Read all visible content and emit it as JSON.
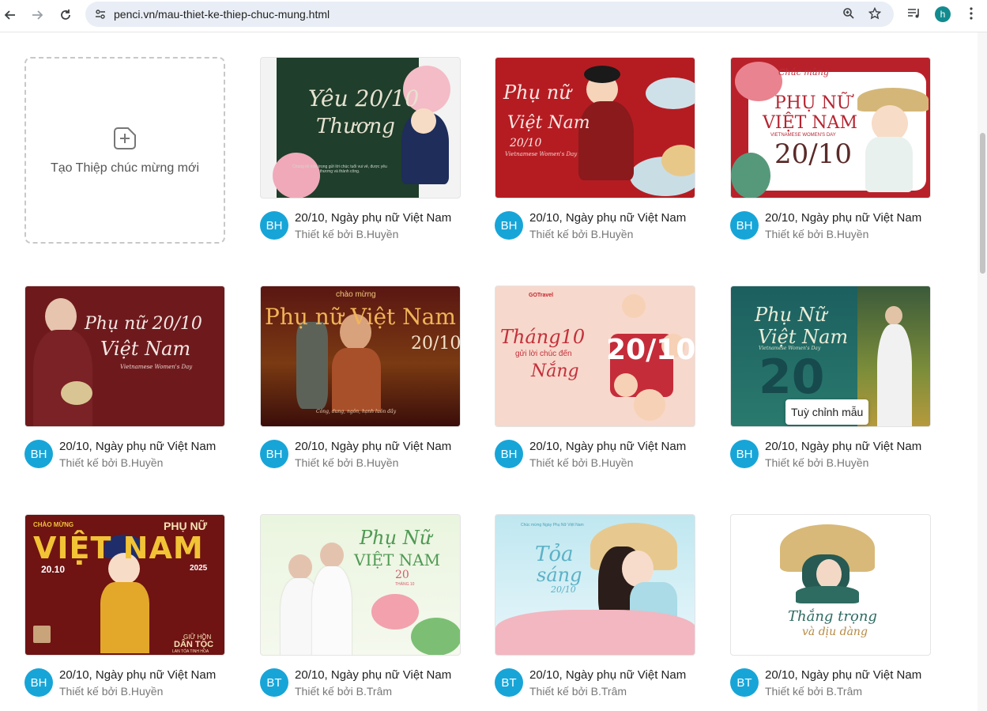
{
  "browser": {
    "url": "penci.vn/mau-thiet-ke-thiep-chuc-mung.html",
    "profile_initial": "h"
  },
  "create": {
    "label": "Tạo Thiệp chúc mừng mới"
  },
  "tooltip": "Tuỳ chỉnh mẫu",
  "cards": [
    {
      "title": "20/10, Ngày phụ nữ Việt Nam",
      "author": "Thiết kế bởi B.Huyền",
      "initials": "BH",
      "art": {
        "lines": [
          "Yêu 20/10",
          "Thương"
        ],
        "small": "Chúng tôi trân trọng gửi lời chúc tuổi vui vẻ, được yêu thương và thành công."
      }
    },
    {
      "title": "20/10, Ngày phụ nữ Việt Nam",
      "author": "Thiết kế bởi B.Huyền",
      "initials": "BH",
      "art": {
        "lines": [
          "Phụ nữ",
          "Việt Nam",
          "20/10"
        ],
        "small": "Vietnamese Women's Day"
      }
    },
    {
      "title": "20/10, Ngày phụ nữ Việt Nam",
      "author": "Thiết kế bởi B.Huyền",
      "initials": "BH",
      "art": {
        "lines": [
          "Chúc mừng",
          "PHỤ NỮ",
          "VIỆT NAM",
          "20/10"
        ],
        "small": "VIETNAMESE WOMEN'S DAY"
      }
    },
    {
      "title": "20/10, Ngày phụ nữ Việt Nam",
      "author": "Thiết kế bởi B.Huyền",
      "initials": "BH",
      "art": {
        "lines": [
          "Phụ nữ 20/10",
          "Việt Nam"
        ],
        "small": "Vietnamese Women's Day"
      }
    },
    {
      "title": "20/10, Ngày phụ nữ Việt Nam",
      "author": "Thiết kế bởi B.Huyền",
      "initials": "BH",
      "art": {
        "lines": [
          "chào mừng",
          "Phụ nữ Việt Nam",
          "20/10"
        ],
        "small": "Công, dung, ngôn, hạnh luôn đầy"
      }
    },
    {
      "title": "20/10, Ngày phụ nữ Việt Nam",
      "author": "Thiết kế bởi B.Huyền",
      "initials": "BH",
      "art": {
        "lines": [
          "Tháng10",
          "gửi lời chúc đến",
          "Nắng",
          "20/10"
        ],
        "small": "GOTravel"
      }
    },
    {
      "title": "20/10, Ngày phụ nữ Việt Nam",
      "author": "Thiết kế bởi B.Huyền",
      "initials": "BH",
      "art": {
        "lines": [
          "Phụ Nữ",
          "Việt Nam",
          "20"
        ],
        "small": "Vietnamese Women's Day"
      }
    },
    {
      "title": "20/10, Ngày phụ nữ Việt Nam",
      "author": "Thiết kế bởi B.Huyền",
      "initials": "BH",
      "art": {
        "lines": [
          "CHÀO MỪNG",
          "PHỤ NỮ",
          "VIỆT NAM",
          "20.10",
          "2025",
          "GIỮ HỒN",
          "DÂN TỘC"
        ],
        "small": "LAN TỎA TINH HOA"
      }
    },
    {
      "title": "20/10, Ngày phụ nữ Việt Nam",
      "author": "Thiết kế bởi B.Trâm",
      "initials": "BT",
      "art": {
        "lines": [
          "Phụ Nữ",
          "VIỆT NAM",
          "20"
        ],
        "small": "THÁNG 10"
      }
    },
    {
      "title": "20/10, Ngày phụ nữ Việt Nam",
      "author": "Thiết kế bởi B.Trâm",
      "initials": "BT",
      "art": {
        "lines": [
          "Tỏa",
          "sáng",
          "20/10"
        ],
        "small": "Chúc mừng Ngày Phụ Nữ Việt Nam"
      }
    },
    {
      "title": "20/10, Ngày phụ nữ Việt Nam",
      "author": "Thiết kế bởi B.Trâm",
      "initials": "BT",
      "art": {
        "lines": [
          "Thắng trọng",
          "và dịu dàng"
        ],
        "small": ""
      }
    }
  ]
}
